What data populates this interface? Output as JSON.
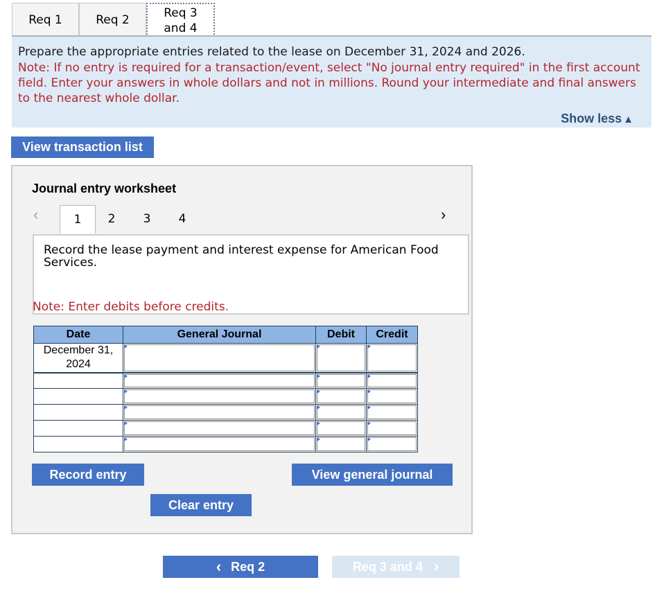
{
  "tabs": [
    {
      "label": "Req 1"
    },
    {
      "label": "Req 2"
    },
    {
      "label_line1": "Req 3",
      "label_line2": "and 4"
    }
  ],
  "instructions": {
    "main": "Prepare the appropriate entries related to the lease on December 31, 2024 and 2026.",
    "note": "Note: If no entry is required for a transaction/event, select \"No journal entry required\" in the first account field. Enter your answers in whole dollars and not in millions. Round your intermediate and final answers to the nearest whole dollar.",
    "show_less": "Show less",
    "show_less_icon": "triangle-up-icon"
  },
  "view_transaction_list": "View transaction list",
  "worksheet": {
    "title": "Journal entry worksheet",
    "pages": [
      "1",
      "2",
      "3",
      "4"
    ],
    "active_page": "1",
    "description": "Record the lease payment and interest expense for American Food Services.",
    "note": "Note: Enter debits before credits.",
    "table": {
      "headers": {
        "date": "Date",
        "journal": "General Journal",
        "debit": "Debit",
        "credit": "Credit"
      },
      "first_date": "December 31, 2024"
    },
    "record_entry": "Record entry",
    "clear_entry": "Clear entry",
    "view_general_journal": "View general journal"
  },
  "nav": {
    "prev": "Req 2",
    "next": "Req 3 and 4"
  },
  "colors": {
    "accent_blue": "#4472c4",
    "note_red": "#b4262c",
    "panel_blue": "#deebf7",
    "header_blue": "#8db4e2"
  }
}
